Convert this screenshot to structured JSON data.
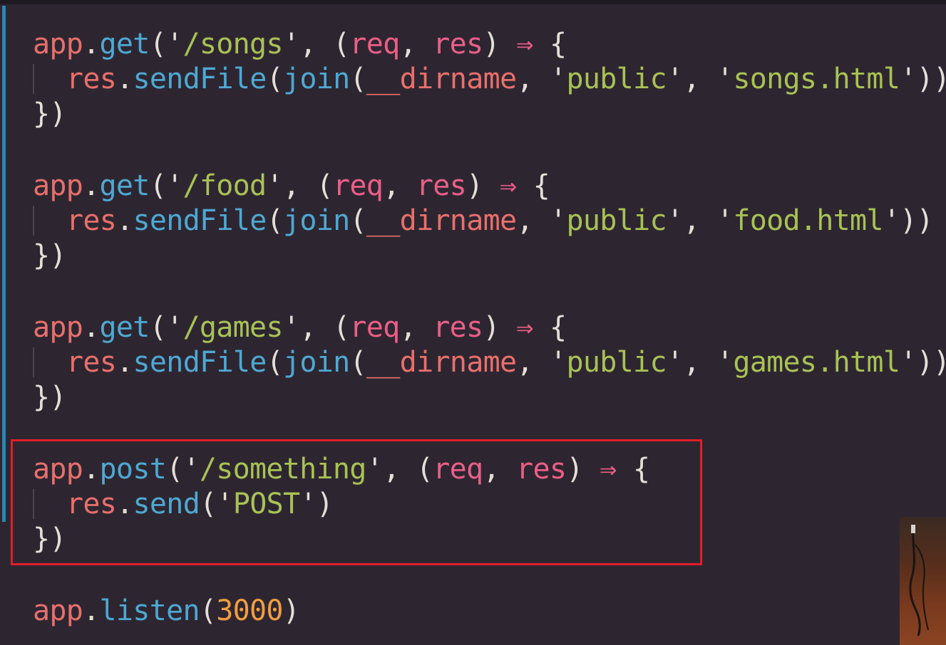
{
  "code": {
    "routes": [
      {
        "app": "app",
        "method": "get",
        "path": "/songs",
        "req": "req",
        "res": "res",
        "body_res": "res",
        "body_fn": "sendFile",
        "join": "join",
        "dirname": "__dirname",
        "folder": "public",
        "file": "songs.html"
      },
      {
        "app": "app",
        "method": "get",
        "path": "/food",
        "req": "req",
        "res": "res",
        "body_res": "res",
        "body_fn": "sendFile",
        "join": "join",
        "dirname": "__dirname",
        "folder": "public",
        "file": "food.html"
      },
      {
        "app": "app",
        "method": "get",
        "path": "/games",
        "req": "req",
        "res": "res",
        "body_res": "res",
        "body_fn": "sendFile",
        "join": "join",
        "dirname": "__dirname",
        "folder": "public",
        "file": "games.html"
      }
    ],
    "post_route": {
      "app": "app",
      "method": "post",
      "path": "/something",
      "req": "req",
      "res": "res",
      "body_res": "res",
      "body_fn": "send",
      "body_arg": "POST"
    },
    "listen": {
      "app": "app",
      "method": "listen",
      "port": "3000"
    },
    "tokens": {
      "dot": ".",
      "open_paren": "(",
      "close_paren": ")",
      "quote": "'",
      "comma_space": ", ",
      "arrow": "⇒",
      "open_brace": "{",
      "close_block": "})",
      "double_close": "))",
      "space": " "
    }
  },
  "colors": {
    "background": "#2d2631",
    "highlight_box": "#e21d2a",
    "git_gutter": "#2a86b5",
    "object": "#e96f6b",
    "property": "#4fa8d2",
    "string": "#a9c254",
    "parameter": "#ec5e87",
    "number": "#f29d3f"
  }
}
